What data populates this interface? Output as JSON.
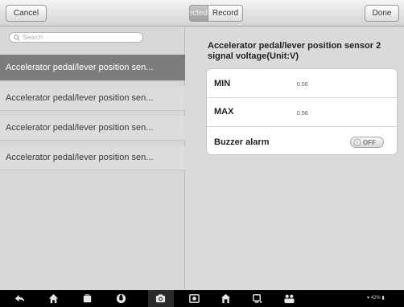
{
  "toolbar": {
    "cancel_label": "Cancel",
    "done_label": "Done",
    "segments": {
      "selected_label": "Selected",
      "record_label": "Record"
    }
  },
  "search": {
    "placeholder": "Search"
  },
  "sensor_list": [
    {
      "label": "Accelerator pedal/lever position sen..."
    },
    {
      "label": "Accelerator pedal/lever position sen..."
    },
    {
      "label": "Accelerator pedal/lever position sen..."
    },
    {
      "label": "Accelerator pedal/lever position sen..."
    }
  ],
  "detail": {
    "title": "Accelerator pedal/lever position sensor 2 signal voltage(Unit:V)",
    "min_label": "MIN",
    "min_value": "0.56",
    "max_label": "MAX",
    "max_value": "0.56",
    "buzzer_label": "Buzzer alarm",
    "buzzer_state": "OFF"
  },
  "navbar": {
    "icons": [
      "back-icon",
      "home-icon",
      "recent-apps-icon",
      "browser-icon",
      "camera-icon",
      "display-icon",
      "vci-icon",
      "shop-icon",
      "remote-support-icon"
    ],
    "status_text": "42%"
  },
  "colors": {
    "selected_item": "#7c7c7c",
    "background": "#d9d9d9",
    "navbar": "#000000"
  }
}
